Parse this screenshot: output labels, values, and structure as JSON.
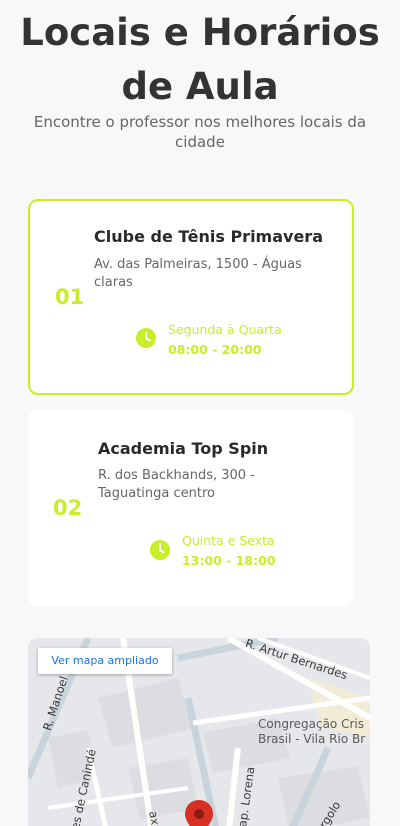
{
  "header": {
    "title_line1": "Locais e Horários",
    "title_line2": "de Aula",
    "subtitle_line1": "Encontre o professor nos melhores locais da",
    "subtitle_line2": "cidade"
  },
  "locations": [
    {
      "number": "01",
      "name": "Clube de Tênis Primavera",
      "address_line1": "Av. das Palmeiras, 1500 - Águas",
      "address_line2": "claras",
      "days": "Segunda à Quarta",
      "hours": "08:00 - 20:00",
      "icon": "clock-icon",
      "selected": true
    },
    {
      "number": "02",
      "name": "Academia Top Spin",
      "address_line1": "R. dos Backhands, 300 -",
      "address_line2": "Taguatinga centro",
      "days": "Quinta e Sexta",
      "hours": "13:00 - 18:00",
      "icon": "clock-icon",
      "selected": false
    }
  ],
  "map": {
    "link_label": "Ver mapa ampliado",
    "streets": [
      "R. Artur Bernardes",
      "R. Manoel",
      "es de Canindé",
      "Cap. Lorena",
      "Argolo",
      "axadá"
    ],
    "poi_line1": "Congregação Cris",
    "poi_line2": "Brasil - Vila Rio Br",
    "pin_icon": "map-pin-icon"
  },
  "colors": {
    "accent": "#c6ef2a",
    "background": "#f8f8f8",
    "link": "#1a73e8",
    "pin": "#d93025"
  }
}
